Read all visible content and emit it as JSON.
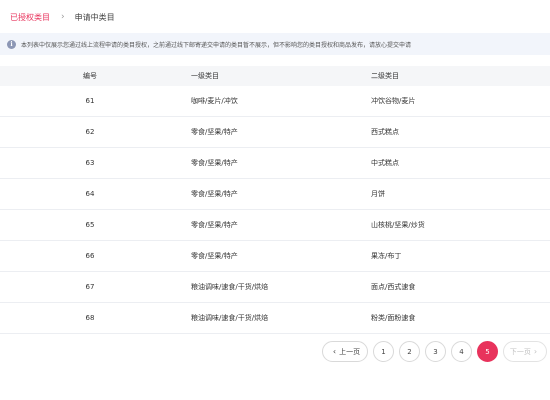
{
  "breadcrumb": {
    "active": "已授权类目",
    "separator": "›",
    "current": "申请中类目"
  },
  "notice": {
    "icon": "info-icon",
    "text": "本列表中仅展示您通过线上流程申请的类目授权，之前通过线下邮寄递交申请的类目暂不展示，但不影响您的类目授权和商品发布，请放心提交申请"
  },
  "table": {
    "headers": [
      "编号",
      "一级类目",
      "二级类目"
    ],
    "rows": [
      [
        "61",
        "咖啡/麦片/冲饮",
        "冲饮谷物/麦片"
      ],
      [
        "62",
        "零食/坚果/特产",
        "西式糕点"
      ],
      [
        "63",
        "零食/坚果/特产",
        "中式糕点"
      ],
      [
        "64",
        "零食/坚果/特产",
        "月饼"
      ],
      [
        "65",
        "零食/坚果/特产",
        "山核桃/坚果/炒货"
      ],
      [
        "66",
        "零食/坚果/特产",
        "果冻/布丁"
      ],
      [
        "67",
        "粮油调味/速食/干货/烘焙",
        "面点/西式速食"
      ],
      [
        "68",
        "粮油调味/速食/干货/烘焙",
        "粉类/面粉速食"
      ]
    ]
  },
  "pagination": {
    "prev_label": "上一页",
    "next_label": "下一页",
    "pages": [
      "1",
      "2",
      "3",
      "4",
      "5"
    ],
    "current": "5",
    "accent_color": "#e8335c"
  }
}
